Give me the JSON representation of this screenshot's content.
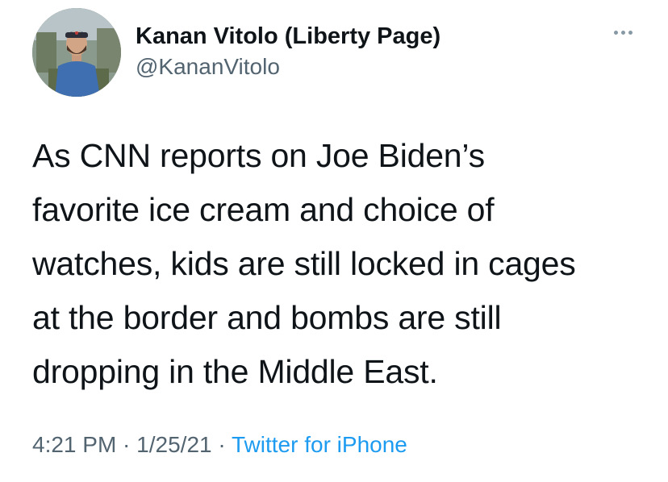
{
  "user": {
    "display_name": "Kanan Vitolo (Liberty Page)",
    "handle": "@KananVitolo"
  },
  "tweet": {
    "lines": [
      "As CNN reports on Joe Biden’s",
      "favorite ice cream and choice of",
      "watches, kids are still locked in cages",
      "at the border and bombs are still",
      "dropping in the Middle East."
    ]
  },
  "meta": {
    "time": "4:21 PM",
    "separator": " · ",
    "date": "1/25/21",
    "source": "Twitter for iPhone"
  },
  "icons": {
    "more": "more-icon"
  },
  "colors": {
    "text": "#0f1419",
    "secondary": "#536471",
    "link": "#1d9bf0"
  }
}
